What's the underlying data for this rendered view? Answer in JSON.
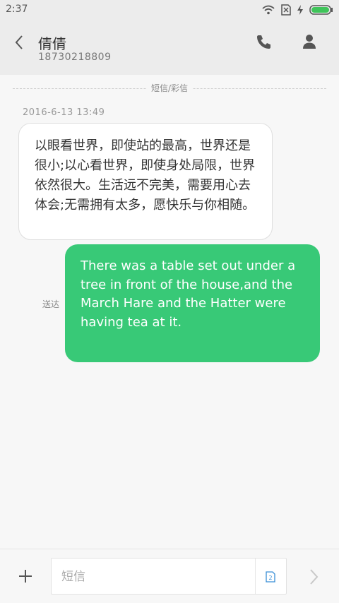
{
  "status_bar": {
    "time": "2:37"
  },
  "header": {
    "contact_name": "倩倩",
    "contact_number": "18730218809"
  },
  "conversation": {
    "divider_label": "短信/彩信",
    "timestamp": "2016-6-13 13:49",
    "incoming_message": "以眼看世界，即使站的最高，世界还是很小;以心看世界，即使身处局限，世界依然很大。生活远不完美，需要用心去体会;无需拥有太多，愿快乐与你相随。",
    "outgoing_message": "There was a table set out under a tree in front of the house,and the March Hare and the Hatter were having tea at it.",
    "delivered_label": "送达"
  },
  "compose": {
    "placeholder": "短信",
    "sim_label": "2"
  },
  "colors": {
    "accent": "#38c977",
    "battery": "#3fc45a"
  },
  "icons": [
    "wifi-icon",
    "no-sim-icon",
    "charging-icon",
    "battery-icon",
    "back-icon",
    "phone-icon",
    "person-icon",
    "plus-icon",
    "sim-icon",
    "send-icon"
  ]
}
